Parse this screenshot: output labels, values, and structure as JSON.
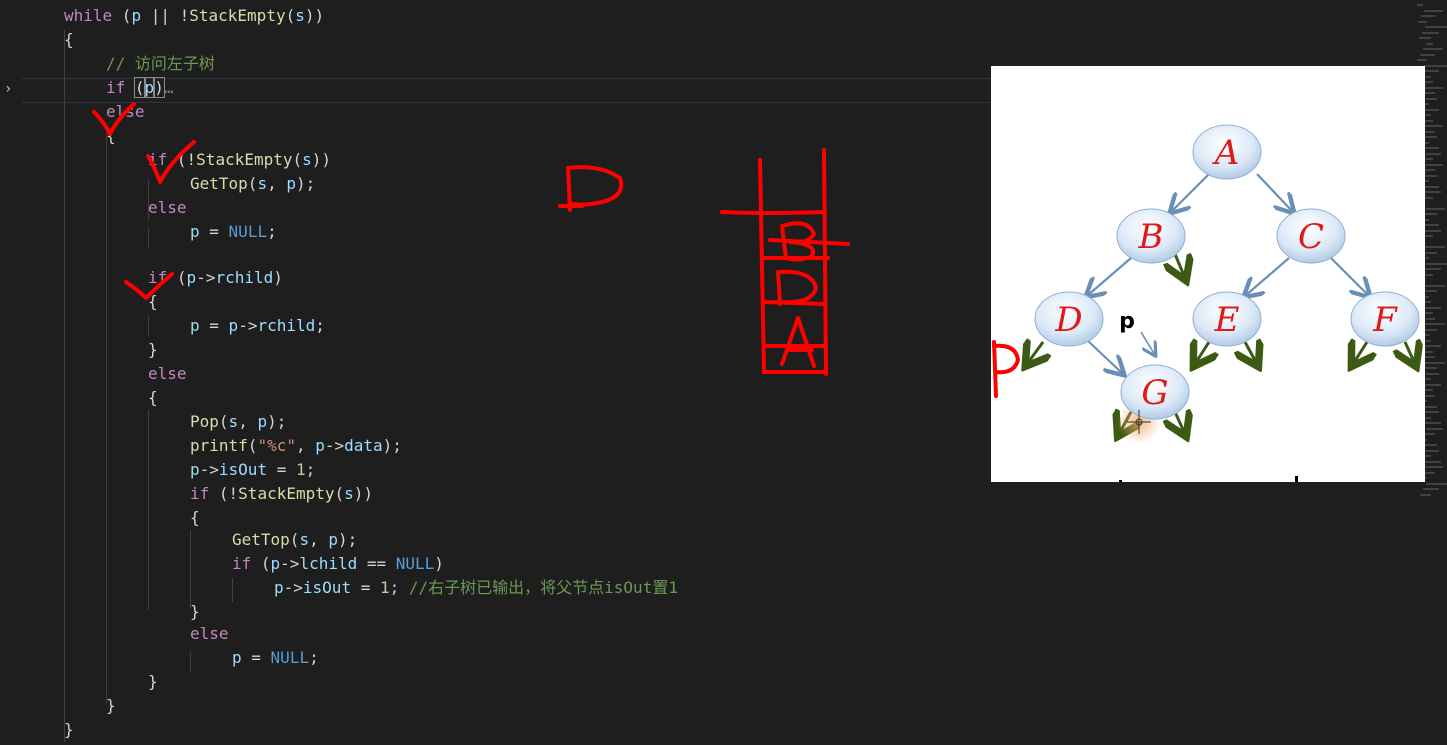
{
  "editor": {
    "lines": [
      [
        {
          "t": "while",
          "c": "kw"
        },
        {
          "t": " (",
          "c": "plain"
        },
        {
          "t": "p",
          "c": "var"
        },
        {
          "t": " || !",
          "c": "plain"
        },
        {
          "t": "StackEmpty",
          "c": "fn"
        },
        {
          "t": "(",
          "c": "plain"
        },
        {
          "t": "s",
          "c": "var"
        },
        {
          "t": "))",
          "c": "plain"
        }
      ],
      [
        {
          "t": "{",
          "c": "plain"
        }
      ],
      [
        {
          "t": "// 访问左子树",
          "c": "cmt"
        }
      ],
      [
        {
          "t": "if",
          "c": "kw"
        },
        {
          "t": " ",
          "c": "plain"
        },
        {
          "t": "(",
          "c": "plain box"
        },
        {
          "t": "p",
          "c": "var box"
        },
        {
          "t": ")",
          "c": "plain box"
        },
        {
          "t": "…",
          "c": "fold-ellipsis"
        }
      ],
      [
        {
          "t": "else",
          "c": "kw"
        }
      ],
      [
        {
          "t": "{",
          "c": "plain"
        }
      ],
      [
        {
          "t": "if",
          "c": "kw"
        },
        {
          "t": " (!",
          "c": "plain"
        },
        {
          "t": "StackEmpty",
          "c": "fn"
        },
        {
          "t": "(",
          "c": "plain"
        },
        {
          "t": "s",
          "c": "var"
        },
        {
          "t": "))",
          "c": "plain"
        }
      ],
      [
        {
          "t": "GetTop",
          "c": "fn"
        },
        {
          "t": "(",
          "c": "plain"
        },
        {
          "t": "s",
          "c": "var"
        },
        {
          "t": ", ",
          "c": "plain"
        },
        {
          "t": "p",
          "c": "var"
        },
        {
          "t": ");",
          "c": "plain"
        }
      ],
      [
        {
          "t": "else",
          "c": "kw"
        }
      ],
      [
        {
          "t": "p",
          "c": "var"
        },
        {
          "t": " = ",
          "c": "plain"
        },
        {
          "t": "NULL",
          "c": "kw2"
        },
        {
          "t": ";",
          "c": "plain"
        }
      ],
      [],
      [
        {
          "t": "if",
          "c": "kw"
        },
        {
          "t": " (",
          "c": "plain"
        },
        {
          "t": "p",
          "c": "var"
        },
        {
          "t": "->",
          "c": "plain"
        },
        {
          "t": "rchild",
          "c": "var"
        },
        {
          "t": ")",
          "c": "plain"
        }
      ],
      [
        {
          "t": "{",
          "c": "plain"
        }
      ],
      [
        {
          "t": "p",
          "c": "var"
        },
        {
          "t": " = ",
          "c": "plain"
        },
        {
          "t": "p",
          "c": "var"
        },
        {
          "t": "->",
          "c": "plain"
        },
        {
          "t": "rchild",
          "c": "var"
        },
        {
          "t": ";",
          "c": "plain"
        }
      ],
      [
        {
          "t": "}",
          "c": "plain"
        }
      ],
      [
        {
          "t": "else",
          "c": "kw"
        }
      ],
      [
        {
          "t": "{",
          "c": "plain"
        }
      ],
      [
        {
          "t": "Pop",
          "c": "fn"
        },
        {
          "t": "(",
          "c": "plain"
        },
        {
          "t": "s",
          "c": "var"
        },
        {
          "t": ", ",
          "c": "plain"
        },
        {
          "t": "p",
          "c": "var"
        },
        {
          "t": ");",
          "c": "plain"
        }
      ],
      [
        {
          "t": "printf",
          "c": "fn"
        },
        {
          "t": "(",
          "c": "plain"
        },
        {
          "t": "\"%c\"",
          "c": "str"
        },
        {
          "t": ", ",
          "c": "plain"
        },
        {
          "t": "p",
          "c": "var"
        },
        {
          "t": "->",
          "c": "plain"
        },
        {
          "t": "data",
          "c": "var"
        },
        {
          "t": ");",
          "c": "plain"
        }
      ],
      [
        {
          "t": "p",
          "c": "var"
        },
        {
          "t": "->",
          "c": "plain"
        },
        {
          "t": "isOut",
          "c": "var"
        },
        {
          "t": " = ",
          "c": "plain"
        },
        {
          "t": "1",
          "c": "num"
        },
        {
          "t": ";",
          "c": "plain"
        }
      ],
      [
        {
          "t": "if",
          "c": "kw"
        },
        {
          "t": " (!",
          "c": "plain"
        },
        {
          "t": "StackEmpty",
          "c": "fn"
        },
        {
          "t": "(",
          "c": "plain"
        },
        {
          "t": "s",
          "c": "var"
        },
        {
          "t": "))",
          "c": "plain"
        }
      ],
      [
        {
          "t": "{",
          "c": "plain"
        }
      ],
      [
        {
          "t": "GetTop",
          "c": "fn"
        },
        {
          "t": "(",
          "c": "plain"
        },
        {
          "t": "s",
          "c": "var"
        },
        {
          "t": ", ",
          "c": "plain"
        },
        {
          "t": "p",
          "c": "var"
        },
        {
          "t": ");",
          "c": "plain"
        }
      ],
      [
        {
          "t": "if",
          "c": "kw"
        },
        {
          "t": " (",
          "c": "plain"
        },
        {
          "t": "p",
          "c": "var"
        },
        {
          "t": "->",
          "c": "plain"
        },
        {
          "t": "lchild",
          "c": "var"
        },
        {
          "t": " == ",
          "c": "plain"
        },
        {
          "t": "NULL",
          "c": "kw2"
        },
        {
          "t": ")",
          "c": "plain"
        }
      ],
      [
        {
          "t": "p",
          "c": "var"
        },
        {
          "t": "->",
          "c": "plain"
        },
        {
          "t": "isOut",
          "c": "var"
        },
        {
          "t": " = ",
          "c": "plain"
        },
        {
          "t": "1",
          "c": "num"
        },
        {
          "t": "; ",
          "c": "plain"
        },
        {
          "t": "//右子树已输出，将父节点isOut置1",
          "c": "cmt"
        }
      ],
      [
        {
          "t": "}",
          "c": "plain"
        }
      ],
      [
        {
          "t": "else",
          "c": "kw"
        }
      ],
      [
        {
          "t": "p",
          "c": "var"
        },
        {
          "t": " = ",
          "c": "plain"
        },
        {
          "t": "NULL",
          "c": "kw2"
        },
        {
          "t": ";",
          "c": "plain"
        }
      ],
      [
        {
          "t": "}",
          "c": "plain"
        }
      ],
      [
        {
          "t": "}",
          "c": "plain"
        }
      ],
      [
        {
          "t": "}",
          "c": "plain"
        }
      ]
    ]
  },
  "fold_icon": "chevron-right-icon",
  "tree": {
    "nodes": [
      "A",
      "B",
      "C",
      "D",
      "E",
      "F",
      "G"
    ],
    "pointer_label": "p"
  },
  "annotations": {
    "handwritten_letters": [
      "p",
      "p",
      "B",
      "D",
      "A"
    ],
    "color": "#ff0000"
  },
  "colors": {
    "background": "#1e1e1e",
    "keyword": "#c586c0",
    "type_keyword": "#569cd6",
    "function": "#dcdcaa",
    "variable": "#9cdcfe",
    "comment": "#6a9955",
    "node_fill": "#d6e6f7",
    "node_text": "#e01818",
    "edge": "#6a8fb4",
    "null_arrow": "#3c5a14"
  }
}
